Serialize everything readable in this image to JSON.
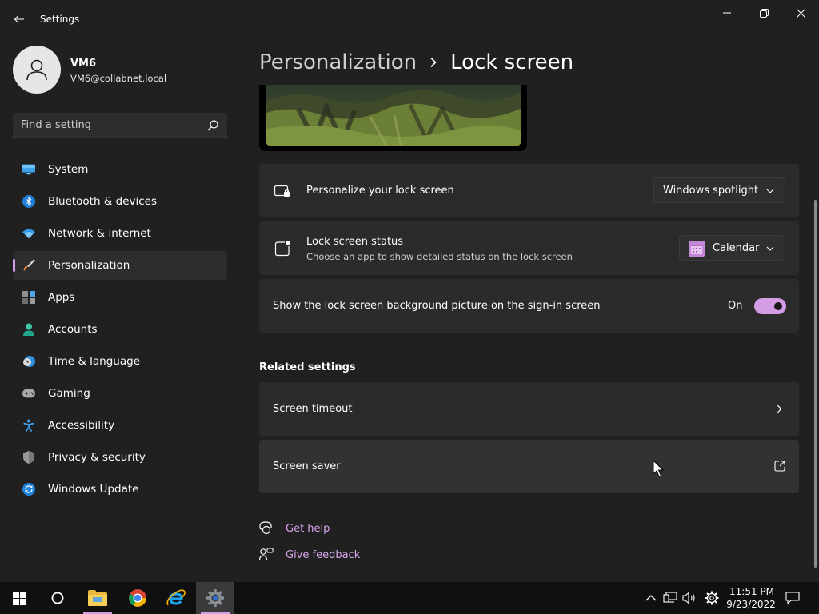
{
  "window": {
    "title": "Settings"
  },
  "profile": {
    "name": "VM6",
    "email": "VM6@collabnet.local"
  },
  "search": {
    "placeholder": "Find a setting"
  },
  "nav": {
    "items": [
      {
        "label": "System",
        "icon": "monitor-icon"
      },
      {
        "label": "Bluetooth & devices",
        "icon": "bluetooth-icon"
      },
      {
        "label": "Network & internet",
        "icon": "wifi-icon"
      },
      {
        "label": "Personalization",
        "icon": "brush-icon",
        "active": true
      },
      {
        "label": "Apps",
        "icon": "apps-icon"
      },
      {
        "label": "Accounts",
        "icon": "person-icon"
      },
      {
        "label": "Time & language",
        "icon": "clock-globe-icon"
      },
      {
        "label": "Gaming",
        "icon": "gamepad-icon"
      },
      {
        "label": "Accessibility",
        "icon": "accessibility-icon"
      },
      {
        "label": "Privacy & security",
        "icon": "shield-icon"
      },
      {
        "label": "Windows Update",
        "icon": "update-icon"
      }
    ]
  },
  "breadcrumb": {
    "parent": "Personalization",
    "current": "Lock screen"
  },
  "settings": {
    "personalize": {
      "title": "Personalize your lock screen",
      "value": "Windows spotlight"
    },
    "status": {
      "title": "Lock screen status",
      "description": "Choose an app to show detailed status on the lock screen",
      "value": "Calendar"
    },
    "signin_bg": {
      "title": "Show the lock screen background picture on the sign-in screen",
      "state": "On"
    }
  },
  "related": {
    "title": "Related settings",
    "items": [
      {
        "label": "Screen timeout",
        "icon": "chevron-right-icon"
      },
      {
        "label": "Screen saver",
        "icon": "external-link-icon"
      }
    ]
  },
  "links": {
    "help": "Get help",
    "feedback": "Give feedback"
  },
  "taskbar": {
    "time": "11:51 PM",
    "date": "9/23/2022"
  },
  "colors": {
    "accent": "#d59ce6",
    "background": "#202020",
    "card": "#2b2b2b"
  }
}
